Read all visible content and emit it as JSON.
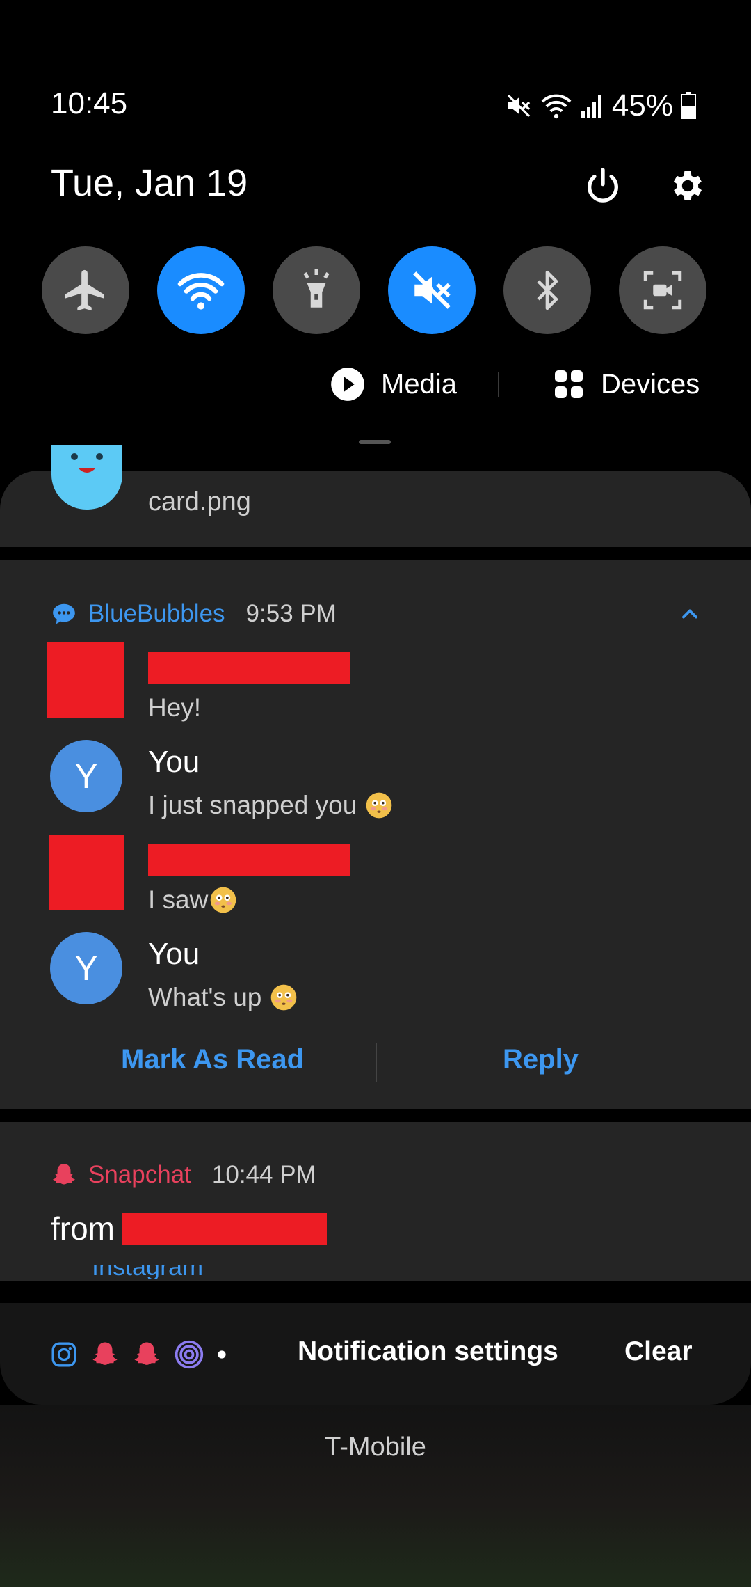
{
  "status_bar": {
    "time": "10:45",
    "battery": "45%",
    "icons": [
      "mute-icon",
      "wifi-icon",
      "signal-icon",
      "battery-icon"
    ]
  },
  "header": {
    "date": "Tue, Jan 19",
    "power_icon": "power-icon",
    "settings_icon": "gear-icon"
  },
  "quick_settings": [
    {
      "name": "airplane-mode",
      "icon": "airplane-icon",
      "on": false
    },
    {
      "name": "wifi",
      "icon": "wifi-icon",
      "on": true
    },
    {
      "name": "flashlight",
      "icon": "flashlight-icon",
      "on": false
    },
    {
      "name": "mute",
      "icon": "mute-icon",
      "on": true
    },
    {
      "name": "bluetooth",
      "icon": "bluetooth-icon",
      "on": false
    },
    {
      "name": "screen-recorder",
      "icon": "screen-record-icon",
      "on": false
    }
  ],
  "media_bar": {
    "media_label": "Media",
    "devices_label": "Devices"
  },
  "notifications": {
    "partial": {
      "text": "card.png"
    },
    "bluebubbles": {
      "app": "BlueBubbles",
      "time": "9:53 PM",
      "messages": [
        {
          "sender": "",
          "text": "Hey!",
          "redacted": true
        },
        {
          "sender": "You",
          "avatar": "Y",
          "text": "I just snapped you",
          "emoji": true
        },
        {
          "sender": "",
          "text": "I saw",
          "redacted": true,
          "emoji": true
        },
        {
          "sender": "You",
          "avatar": "Y",
          "text": "What's up",
          "emoji": true
        }
      ],
      "actions": {
        "mark_read": "Mark As Read",
        "reply": "Reply"
      }
    },
    "snapchat": {
      "app": "Snapchat",
      "time": "10:44 PM",
      "text": "from",
      "peek": "Instagram"
    }
  },
  "bottom_bar": {
    "icons": [
      "instagram-icon",
      "snapchat-icon",
      "snapchat-icon",
      "threads-icon"
    ],
    "notification_settings": "Notification settings",
    "clear": "Clear"
  },
  "lockscreen": {
    "carrier": "T-Mobile"
  },
  "colors": {
    "accent_blue": "#1a8cff",
    "link_blue": "#3d97f0",
    "snapchat_red": "#e8415d",
    "redaction_red": "#ed1c24"
  }
}
